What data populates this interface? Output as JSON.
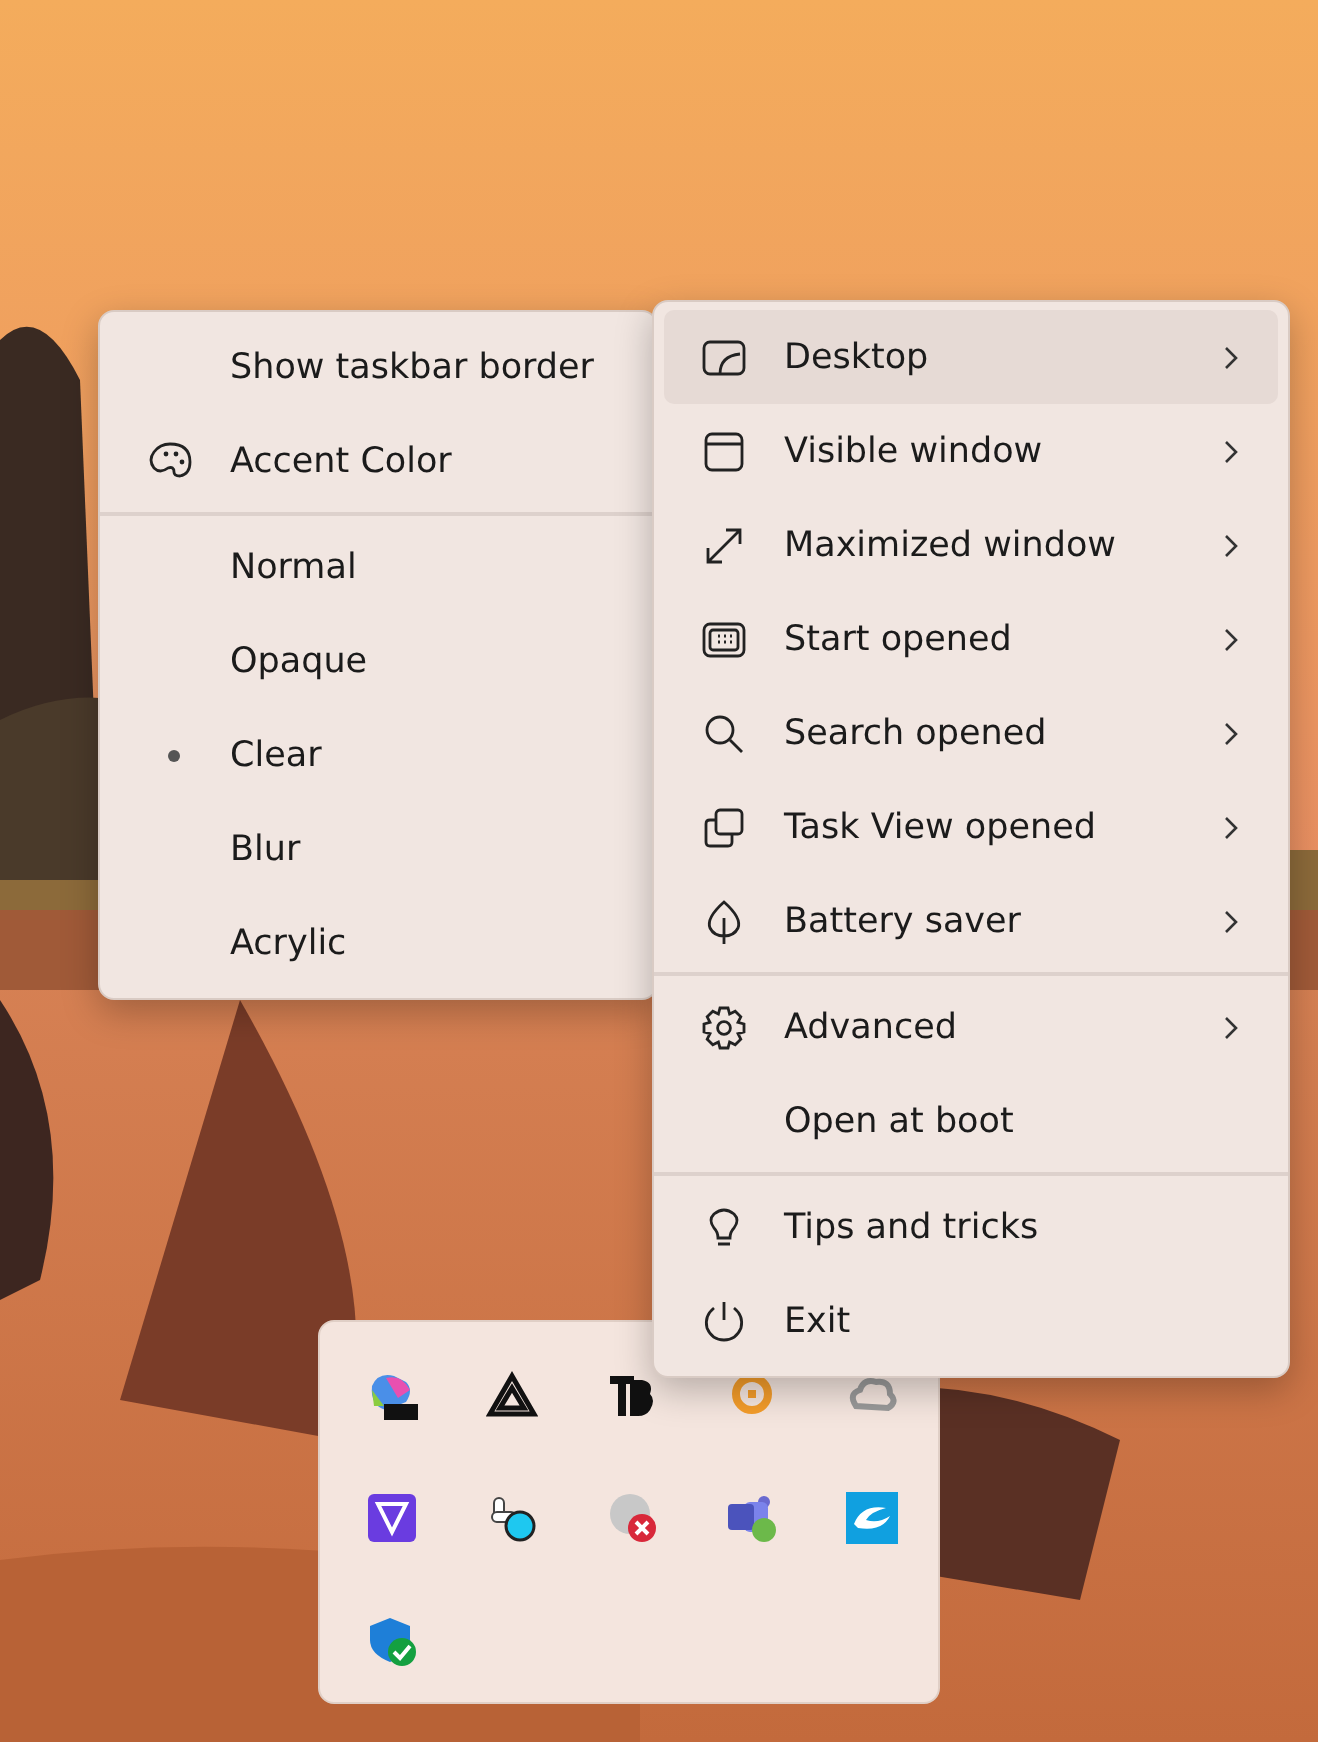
{
  "submenu": {
    "groups": [
      {
        "items": [
          {
            "kind": "plain",
            "label": "Show taskbar border"
          },
          {
            "kind": "icon",
            "label": "Accent Color"
          }
        ]
      },
      {
        "items": [
          {
            "kind": "radio",
            "label": "Normal",
            "selected": false
          },
          {
            "kind": "radio",
            "label": "Opaque",
            "selected": false
          },
          {
            "kind": "radio",
            "label": "Clear",
            "selected": true
          },
          {
            "kind": "radio",
            "label": "Blur",
            "selected": false
          },
          {
            "kind": "radio",
            "label": "Acrylic",
            "selected": false
          }
        ]
      }
    ]
  },
  "main_menu": {
    "groups": [
      {
        "items": [
          {
            "label": "Desktop",
            "has_submenu": true,
            "highlighted": true
          },
          {
            "label": "Visible window",
            "has_submenu": true,
            "highlighted": false
          },
          {
            "label": "Maximized window",
            "has_submenu": true,
            "highlighted": false
          },
          {
            "label": "Start opened",
            "has_submenu": true,
            "highlighted": false
          },
          {
            "label": "Search opened",
            "has_submenu": true,
            "highlighted": false
          },
          {
            "label": "Task View opened",
            "has_submenu": true,
            "highlighted": false
          },
          {
            "label": "Battery saver",
            "has_submenu": true,
            "highlighted": false
          }
        ]
      },
      {
        "items": [
          {
            "label": "Advanced",
            "has_submenu": true,
            "highlighted": false
          },
          {
            "label": "Open at boot",
            "has_submenu": false,
            "highlighted": false
          }
        ]
      },
      {
        "items": [
          {
            "label": "Tips and tricks",
            "has_submenu": false,
            "highlighted": false
          },
          {
            "label": "Exit",
            "has_submenu": false,
            "highlighted": false
          }
        ]
      }
    ]
  }
}
